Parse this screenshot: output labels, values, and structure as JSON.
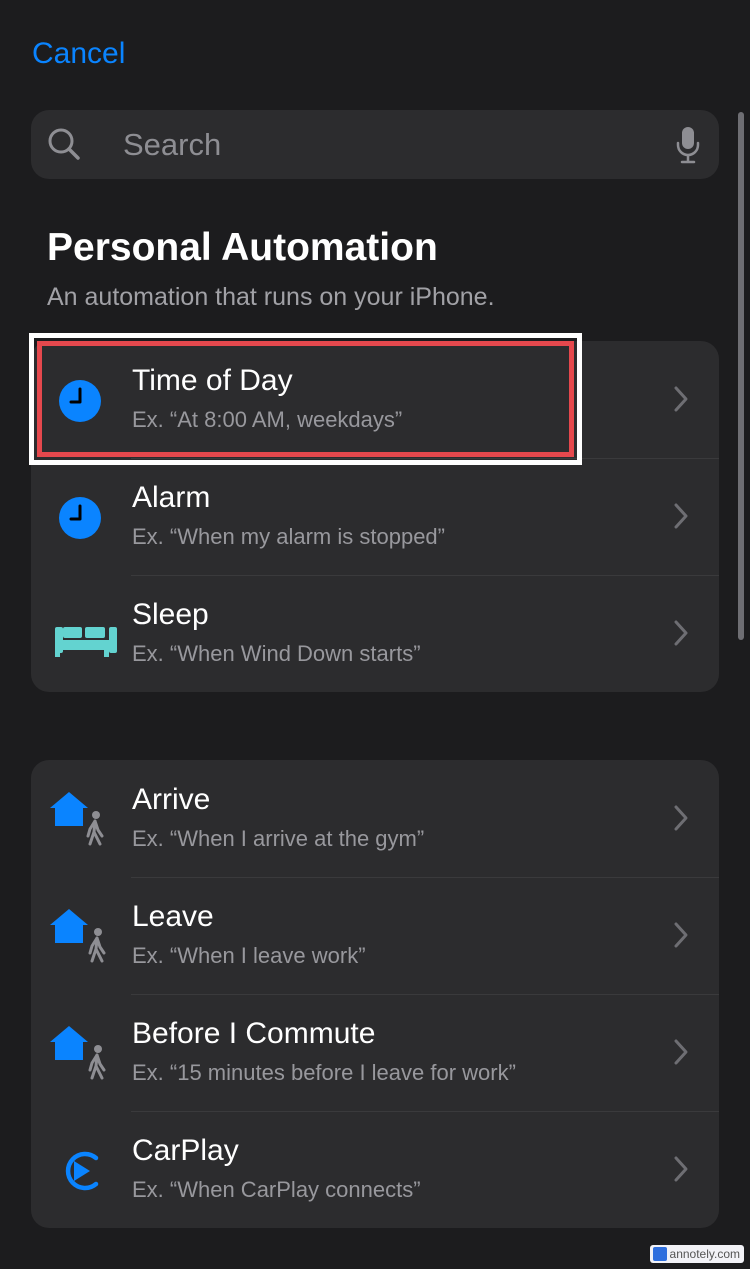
{
  "header": {
    "cancel_label": "Cancel"
  },
  "search": {
    "placeholder": "Search",
    "search_icon": "magnifyingglass-icon",
    "mic_icon": "microphone-icon"
  },
  "section": {
    "title": "Personal Automation",
    "subtitle": "An automation that runs on your iPhone."
  },
  "group1": [
    {
      "label": "Time of Day",
      "example": "Ex. “At 8:00 AM, weekdays”",
      "icon": "clock-icon"
    },
    {
      "label": "Alarm",
      "example": "Ex. “When my alarm is stopped”",
      "icon": "clock-icon"
    },
    {
      "label": "Sleep",
      "example": "Ex. “When Wind Down starts”",
      "icon": "bed-icon"
    }
  ],
  "group2": [
    {
      "label": "Arrive",
      "example": "Ex. “When I arrive at the gym”",
      "icon": "house-walking-icon"
    },
    {
      "label": "Leave",
      "example": "Ex. “When I leave work”",
      "icon": "house-walking-icon"
    },
    {
      "label": "Before I Commute",
      "example": "Ex. “15 minutes before I leave for work”",
      "icon": "house-walking-icon"
    },
    {
      "label": "CarPlay",
      "example": "Ex. “When CarPlay connects”",
      "icon": "carplay-icon"
    }
  ],
  "colors": {
    "accent": "#0a84ff",
    "sleep": "#63d3d0",
    "highlight": "#e5484d"
  },
  "watermark": {
    "text": "annotely.com"
  }
}
